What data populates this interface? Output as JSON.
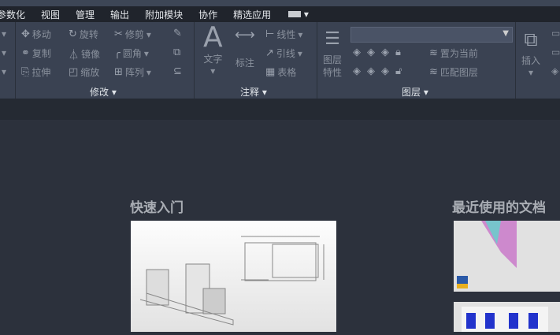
{
  "menu": [
    "参数化",
    "视图",
    "管理",
    "输出",
    "附加模块",
    "协作",
    "精选应用"
  ],
  "ribbon": {
    "modify": {
      "tools": [
        "移动",
        "旋转",
        "修剪",
        "复制",
        "镜像",
        "圆角",
        "拉伸",
        "缩放",
        "阵列"
      ],
      "label": "修改"
    },
    "annotation": {
      "text": "文字",
      "dimension": "标注",
      "linear": "线性",
      "leader": "引线",
      "table": "表格",
      "label": "注释"
    },
    "layers": {
      "properties": [
        "图层",
        "特性"
      ],
      "set_current": "置为当前",
      "match": "匹配图层",
      "label": "图层"
    },
    "block": {
      "insert": "插入"
    }
  },
  "start": {
    "quick_start": "快速入门",
    "recent_docs": "最近使用的文档"
  }
}
